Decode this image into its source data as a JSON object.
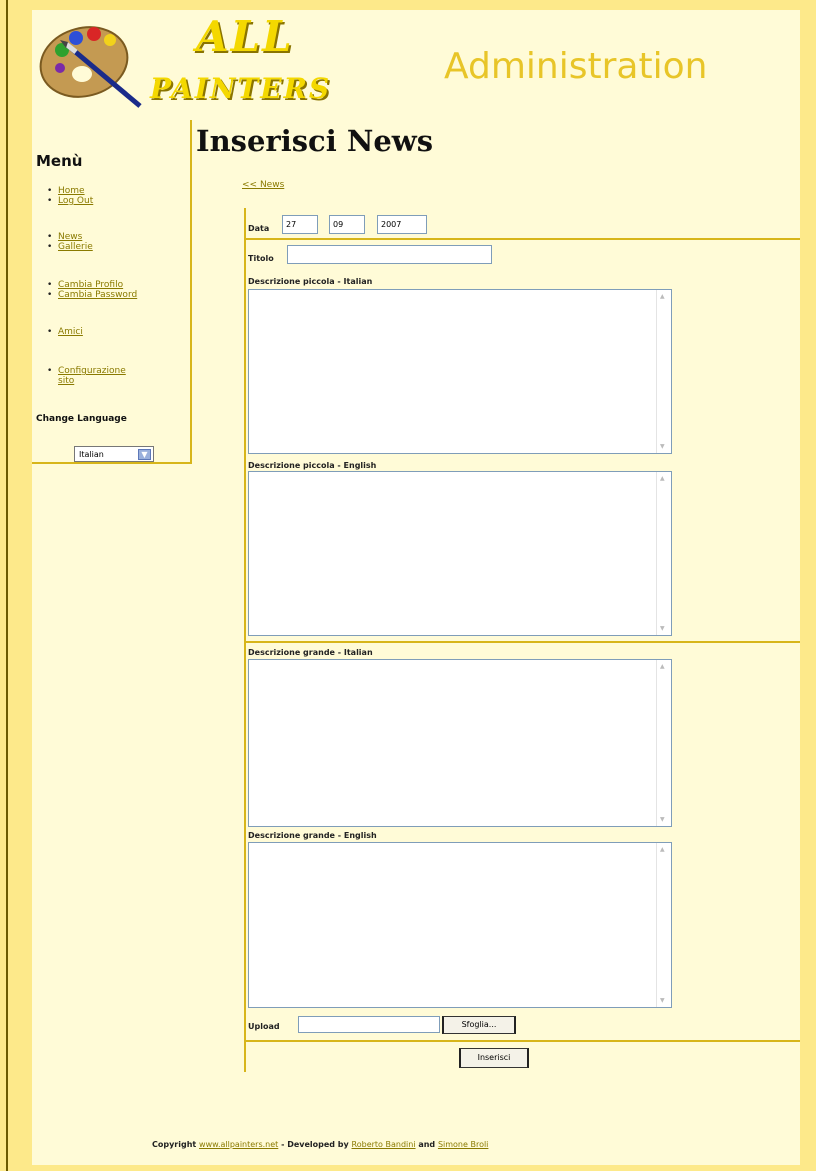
{
  "header": {
    "logo_line1": "ALL",
    "logo_line2": "PAINTERS",
    "admin_title": "Administration"
  },
  "sidebar": {
    "title": "Menù",
    "group1": [
      "Home",
      "Log Out"
    ],
    "group2": [
      "News",
      "Gallerie"
    ],
    "group3": [
      "Cambia Profilo",
      "Cambia Password"
    ],
    "group4": [
      "Amici"
    ],
    "group5_line1": "Configurazione",
    "group5_line2": "sito",
    "change_language": "Change Language",
    "language_value": "Italian"
  },
  "main": {
    "title": "Inserisci News",
    "back_link": "<< News",
    "date_label": "Data",
    "date_day": "27",
    "date_month": "09",
    "date_year": "2007",
    "titolo_label": "Titolo",
    "desc_small_it": "Descrizione piccola - Italian",
    "desc_small_en": "Descrizione piccola - English",
    "desc_big_it": "Descrizione grande - Italian",
    "desc_big_en": "Descrizione grande - English",
    "upload_label": "Upload",
    "browse_button": "Sfoglia...",
    "submit_button": "Inserisci"
  },
  "footer": {
    "copyright": "Copyright",
    "site_link": "www.allpainters.net",
    "developed_by": " - Developed by ",
    "author1": "Roberto Bandini",
    "and": " and ",
    "author2": "Simone Broli"
  }
}
